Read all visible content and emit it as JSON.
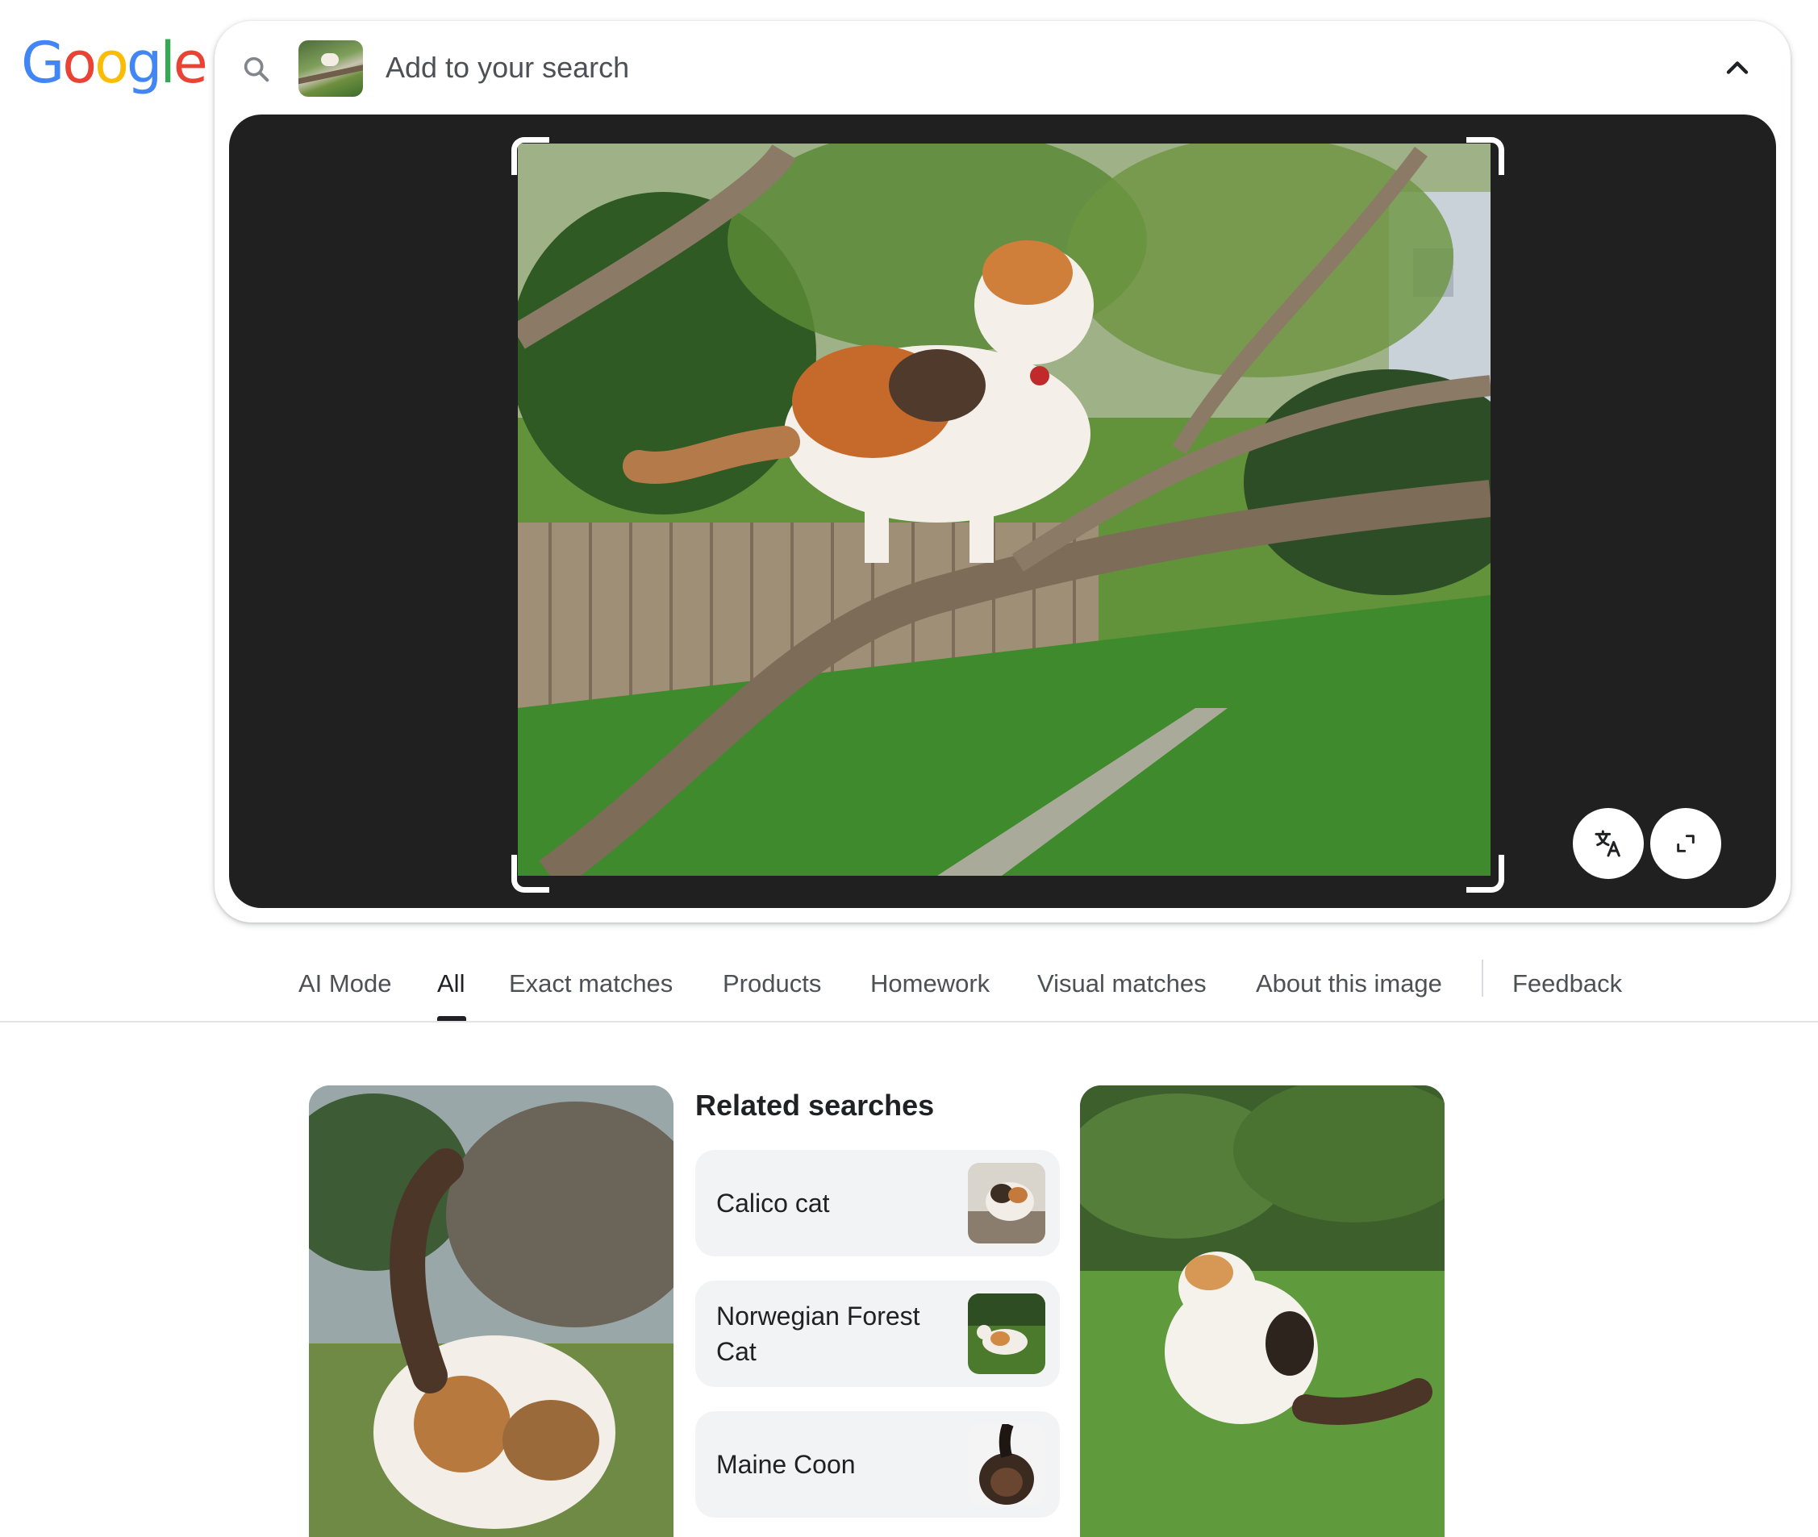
{
  "logo": {
    "letters": [
      "G",
      "o",
      "o",
      "g",
      "l",
      "e"
    ],
    "colors": [
      "#4285F4",
      "#EA4335",
      "#FBBC05",
      "#4285F4",
      "#34A853",
      "#EA4335"
    ]
  },
  "search": {
    "placeholder": "Add to your search",
    "search_icon": "search-icon",
    "collapse_icon": "chevron-up-icon"
  },
  "image_panel": {
    "translate_icon": "translate-icon",
    "expand_icon": "expand-icon"
  },
  "tabs": [
    {
      "label": "AI Mode",
      "active": false
    },
    {
      "label": "All",
      "active": true
    },
    {
      "label": "Exact matches",
      "active": false
    },
    {
      "label": "Products",
      "active": false
    },
    {
      "label": "Homework",
      "active": false
    },
    {
      "label": "Visual matches",
      "active": false
    },
    {
      "label": "About this image",
      "active": false
    },
    {
      "label": "Feedback",
      "active": false
    }
  ],
  "related": {
    "title": "Related searches",
    "items": [
      {
        "label": "Calico cat"
      },
      {
        "label": "Norwegian Forest Cat"
      },
      {
        "label": "Maine Coon"
      }
    ]
  },
  "colors": {
    "panel_bg": "#202020",
    "chip_bg": "#f1f3f4",
    "text_secondary": "#4d5156",
    "text_primary": "#202124"
  }
}
